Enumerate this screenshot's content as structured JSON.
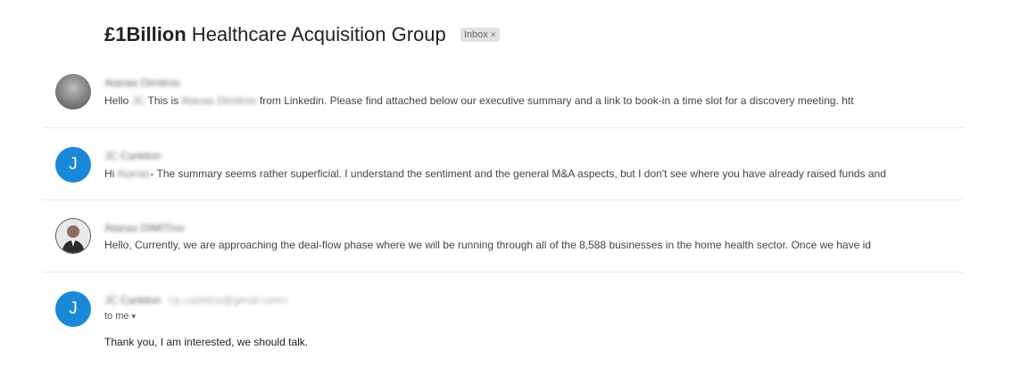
{
  "thread": {
    "subject_prefix": "£1Billion",
    "subject_rest": " Healthcare Acquisition Group",
    "label": "Inbox",
    "label_close": "×"
  },
  "messages": [
    {
      "sender": "Atanas Dimitrov",
      "snippet_greeting": "Hello",
      "snippet_name1": "JC",
      "snippet_mid": " This is ",
      "snippet_name2": "Atanas Dimitrov",
      "snippet_rest": " from Linkedin. Please find attached below our executive summary and a link to book-in a time slot for a discovery meeting. htt"
    },
    {
      "avatar_letter": "J",
      "sender": "JC Carleton",
      "snippet_greeting": "Hi",
      "snippet_name1": "Atanas",
      "snippet_rest": "- The summary seems rather superficial. I understand the sentiment and the general M&A aspects, but I don't see where you have already raised funds and"
    },
    {
      "sender": "Atanas DIMITrov",
      "snippet": "Hello, Currently, we are approaching the deal-flow phase where we will be running through all of the 8,588 businesses in the home health sector. Once we have id"
    },
    {
      "avatar_letter": "J",
      "sender": "JC Carleton",
      "sender_email": "<jc.carleton@gmail.com>",
      "to_me": "to me",
      "caret": "▾",
      "body": "Thank you, I am interested, we should talk."
    }
  ]
}
